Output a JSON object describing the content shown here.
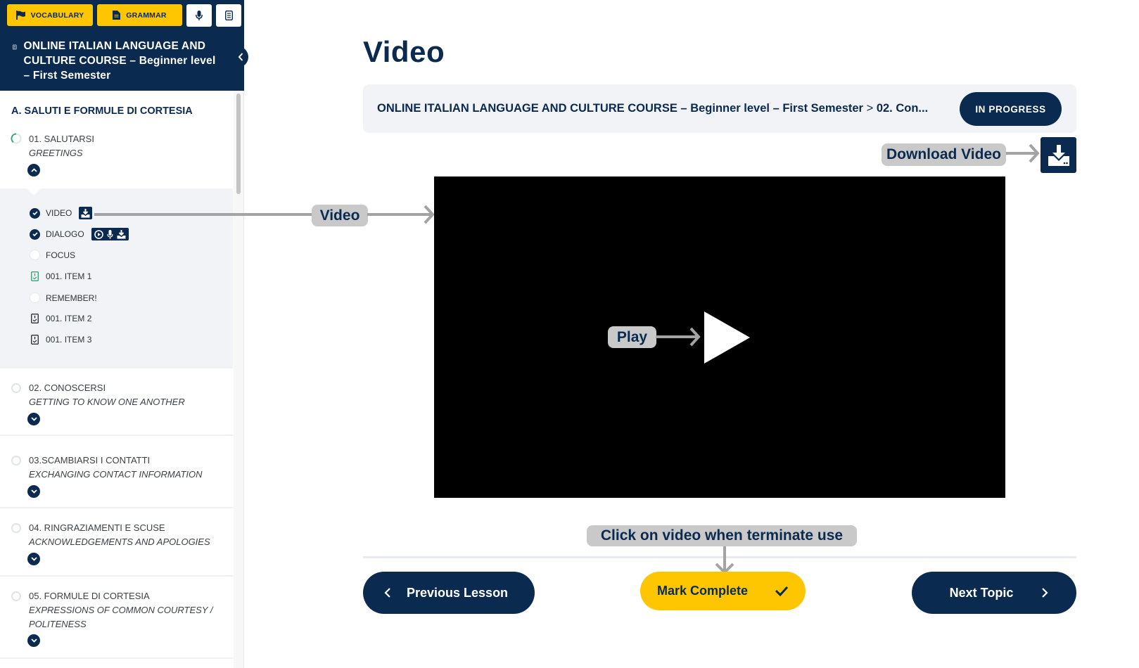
{
  "sidebar": {
    "topbar": {
      "vocabulary_label": "VOCABULARY",
      "grammar_label": "GRAMMAR",
      "icons": [
        "flag-icon",
        "document-icon",
        "microphone-icon",
        "notebook-icon"
      ]
    },
    "course_title": "ONLINE ITALIAN LANGUAGE AND CULTURE COURSE – Beginner level – First Semester",
    "section_title": "A. SALUTI E FORMULE DI CORTESIA",
    "lessons": [
      {
        "title": "01. SALUTARSI",
        "subtitle": "GREETINGS",
        "status": "in-progress",
        "expanded": true,
        "topics": [
          {
            "label": "VIDEO",
            "status": "complete",
            "badges": [
              "download-icon"
            ]
          },
          {
            "label": "DIALOGO",
            "status": "complete",
            "badges": [
              "play-circle-icon",
              "microphone-icon",
              "download-icon"
            ]
          },
          {
            "label": "FOCUS",
            "status": "incomplete"
          },
          {
            "label": "001. ITEM 1",
            "status": "quiz-active"
          },
          {
            "label": "REMEMBER!",
            "status": "incomplete"
          },
          {
            "label": "001. ITEM 2",
            "status": "quiz"
          },
          {
            "label": "001. ITEM 3",
            "status": "quiz"
          }
        ]
      },
      {
        "title": "02. CONOSCERSI",
        "subtitle": "GETTING TO KNOW ONE ANOTHER",
        "status": "incomplete",
        "expanded": false
      },
      {
        "title": "03.SCAMBIARSI I CONTATTI",
        "subtitle": "EXCHANGING CONTACT INFORMATION",
        "status": "incomplete",
        "expanded": false
      },
      {
        "title": "04. RINGRAZIAMENTI E SCUSE",
        "subtitle": "ACKNOWLEDGEMENTS AND APOLOGIES",
        "status": "incomplete",
        "expanded": false
      },
      {
        "title": "05. FORMULE DI CORTESIA",
        "subtitle": "EXPRESSIONS OF COMMON COURTESY / POLITENESS",
        "status": "incomplete",
        "expanded": false
      }
    ]
  },
  "main": {
    "page_title": "Video",
    "breadcrumb": {
      "course": "ONLINE ITALIAN LANGUAGE AND CULTURE COURSE – Beginner level – First Semester",
      "separator": ">",
      "current": "02. Con..."
    },
    "status_badge": "IN PROGRESS",
    "annotations": {
      "download_video": "Download Video",
      "video": "Video",
      "play": "Play",
      "mark_hint": "Click on video when terminate use"
    },
    "buttons": {
      "previous": "Previous Lesson",
      "mark_complete": "Mark Complete",
      "next": "Next Topic"
    }
  },
  "colors": {
    "navy": "#0b2a4f",
    "yellow": "#fdc600",
    "panel": "#f1f3f6",
    "annotation": "#c9c9c9",
    "quiz_active": "#3aa57a"
  }
}
